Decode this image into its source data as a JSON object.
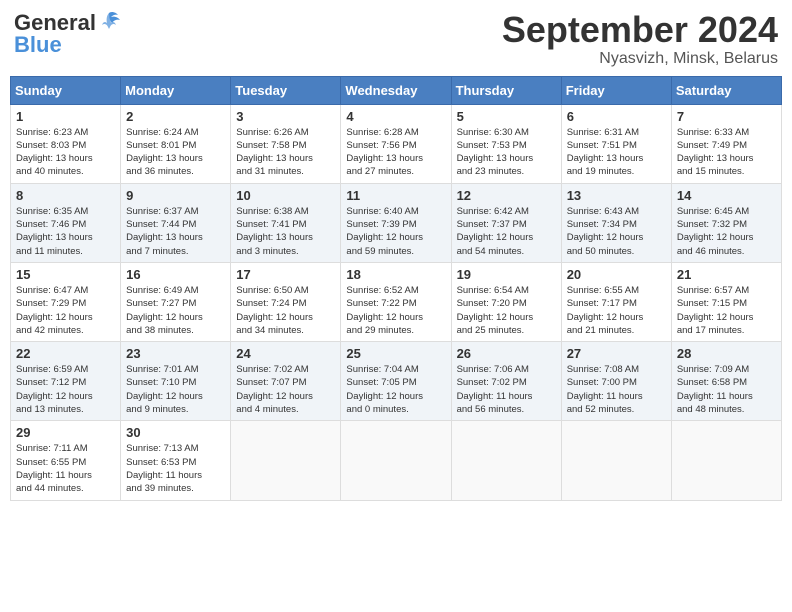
{
  "header": {
    "logo_general": "General",
    "logo_blue": "Blue",
    "month_title": "September 2024",
    "location": "Nyasvizh, Minsk, Belarus"
  },
  "calendar": {
    "days_of_week": [
      "Sunday",
      "Monday",
      "Tuesday",
      "Wednesday",
      "Thursday",
      "Friday",
      "Saturday"
    ],
    "weeks": [
      [
        {
          "day": "1",
          "sunrise": "6:23 AM",
          "sunset": "8:03 PM",
          "daylight": "13 hours and 40 minutes."
        },
        {
          "day": "2",
          "sunrise": "6:24 AM",
          "sunset": "8:01 PM",
          "daylight": "13 hours and 36 minutes."
        },
        {
          "day": "3",
          "sunrise": "6:26 AM",
          "sunset": "7:58 PM",
          "daylight": "13 hours and 31 minutes."
        },
        {
          "day": "4",
          "sunrise": "6:28 AM",
          "sunset": "7:56 PM",
          "daylight": "13 hours and 27 minutes."
        },
        {
          "day": "5",
          "sunrise": "6:30 AM",
          "sunset": "7:53 PM",
          "daylight": "13 hours and 23 minutes."
        },
        {
          "day": "6",
          "sunrise": "6:31 AM",
          "sunset": "7:51 PM",
          "daylight": "13 hours and 19 minutes."
        },
        {
          "day": "7",
          "sunrise": "6:33 AM",
          "sunset": "7:49 PM",
          "daylight": "13 hours and 15 minutes."
        }
      ],
      [
        {
          "day": "8",
          "sunrise": "6:35 AM",
          "sunset": "7:46 PM",
          "daylight": "13 hours and 11 minutes."
        },
        {
          "day": "9",
          "sunrise": "6:37 AM",
          "sunset": "7:44 PM",
          "daylight": "13 hours and 7 minutes."
        },
        {
          "day": "10",
          "sunrise": "6:38 AM",
          "sunset": "7:41 PM",
          "daylight": "13 hours and 3 minutes."
        },
        {
          "day": "11",
          "sunrise": "6:40 AM",
          "sunset": "7:39 PM",
          "daylight": "12 hours and 59 minutes."
        },
        {
          "day": "12",
          "sunrise": "6:42 AM",
          "sunset": "7:37 PM",
          "daylight": "12 hours and 54 minutes."
        },
        {
          "day": "13",
          "sunrise": "6:43 AM",
          "sunset": "7:34 PM",
          "daylight": "12 hours and 50 minutes."
        },
        {
          "day": "14",
          "sunrise": "6:45 AM",
          "sunset": "7:32 PM",
          "daylight": "12 hours and 46 minutes."
        }
      ],
      [
        {
          "day": "15",
          "sunrise": "6:47 AM",
          "sunset": "7:29 PM",
          "daylight": "12 hours and 42 minutes."
        },
        {
          "day": "16",
          "sunrise": "6:49 AM",
          "sunset": "7:27 PM",
          "daylight": "12 hours and 38 minutes."
        },
        {
          "day": "17",
          "sunrise": "6:50 AM",
          "sunset": "7:24 PM",
          "daylight": "12 hours and 34 minutes."
        },
        {
          "day": "18",
          "sunrise": "6:52 AM",
          "sunset": "7:22 PM",
          "daylight": "12 hours and 29 minutes."
        },
        {
          "day": "19",
          "sunrise": "6:54 AM",
          "sunset": "7:20 PM",
          "daylight": "12 hours and 25 minutes."
        },
        {
          "day": "20",
          "sunrise": "6:55 AM",
          "sunset": "7:17 PM",
          "daylight": "12 hours and 21 minutes."
        },
        {
          "day": "21",
          "sunrise": "6:57 AM",
          "sunset": "7:15 PM",
          "daylight": "12 hours and 17 minutes."
        }
      ],
      [
        {
          "day": "22",
          "sunrise": "6:59 AM",
          "sunset": "7:12 PM",
          "daylight": "12 hours and 13 minutes."
        },
        {
          "day": "23",
          "sunrise": "7:01 AM",
          "sunset": "7:10 PM",
          "daylight": "12 hours and 9 minutes."
        },
        {
          "day": "24",
          "sunrise": "7:02 AM",
          "sunset": "7:07 PM",
          "daylight": "12 hours and 4 minutes."
        },
        {
          "day": "25",
          "sunrise": "7:04 AM",
          "sunset": "7:05 PM",
          "daylight": "12 hours and 0 minutes."
        },
        {
          "day": "26",
          "sunrise": "7:06 AM",
          "sunset": "7:02 PM",
          "daylight": "11 hours and 56 minutes."
        },
        {
          "day": "27",
          "sunrise": "7:08 AM",
          "sunset": "7:00 PM",
          "daylight": "11 hours and 52 minutes."
        },
        {
          "day": "28",
          "sunrise": "7:09 AM",
          "sunset": "6:58 PM",
          "daylight": "11 hours and 48 minutes."
        }
      ],
      [
        {
          "day": "29",
          "sunrise": "7:11 AM",
          "sunset": "6:55 PM",
          "daylight": "11 hours and 44 minutes."
        },
        {
          "day": "30",
          "sunrise": "7:13 AM",
          "sunset": "6:53 PM",
          "daylight": "11 hours and 39 minutes."
        },
        {
          "day": "",
          "sunrise": "",
          "sunset": "",
          "daylight": ""
        },
        {
          "day": "",
          "sunrise": "",
          "sunset": "",
          "daylight": ""
        },
        {
          "day": "",
          "sunrise": "",
          "sunset": "",
          "daylight": ""
        },
        {
          "day": "",
          "sunrise": "",
          "sunset": "",
          "daylight": ""
        },
        {
          "day": "",
          "sunrise": "",
          "sunset": "",
          "daylight": ""
        }
      ]
    ]
  }
}
